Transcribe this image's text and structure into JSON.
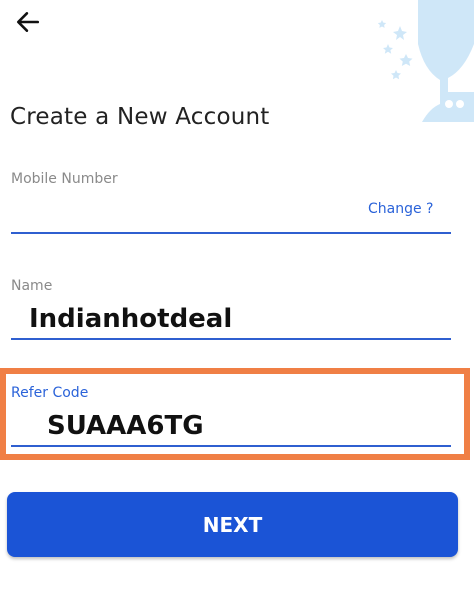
{
  "header": {
    "back_icon": "arrow-left-icon",
    "decoration_icon": "trophy-icon"
  },
  "page_title": "Create a New Account",
  "mobile": {
    "label": "Mobile Number",
    "value": "",
    "change_link": "Change ?"
  },
  "name": {
    "label": "Name",
    "value": "Indianhotdeal"
  },
  "refer": {
    "label": "Refer Code",
    "value": "SUAAA6TG"
  },
  "next_button": "NEXT",
  "colors": {
    "accent": "#2b63d9",
    "button": "#1b54d6",
    "highlight": "#f07f45",
    "trophy": "#cfe7f8"
  }
}
